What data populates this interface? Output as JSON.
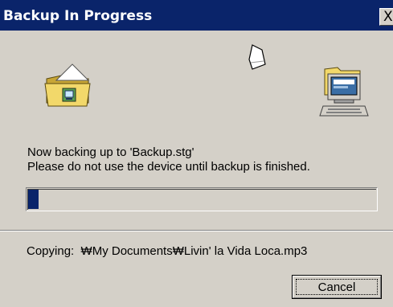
{
  "window": {
    "title": "Backup In Progress",
    "close_glyph": "X"
  },
  "icons": {
    "source": "folder-with-document-icon",
    "flying": "document-icon",
    "destination": "computer-icon"
  },
  "status": {
    "line1": "Now backing up to 'Backup.stg'",
    "line2": "Please do not use the device until backup is finished."
  },
  "progress": {
    "fraction": 0.03
  },
  "copying": {
    "text": "Copying:  ₩My Documents₩Livin' la Vida Loca.mp3"
  },
  "buttons": {
    "cancel": "Cancel"
  },
  "colors": {
    "titlebar": "#0a246a",
    "progress_fill": "#0a246a",
    "face": "#d4d0c8"
  }
}
